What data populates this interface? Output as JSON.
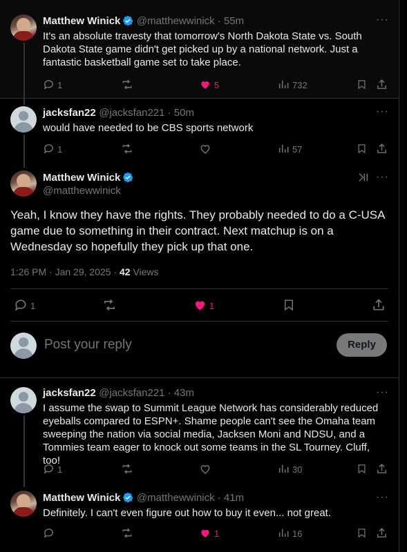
{
  "colors": {
    "background": "#000000",
    "text": "#e7e9ea",
    "muted": "#71767b",
    "like": "#f91880",
    "verified": "#1d9bf0",
    "divider": "#2f3336"
  },
  "tweet1": {
    "name": "Matthew Winick",
    "handle": "@matthewwinick · 55m",
    "text": "It's an absolute travesty that tomorrow's North Dakota State vs. South Dakota State game didn't get picked up by a national network. Just a fantastic basketball game set to take place.",
    "replies": "1",
    "reposts": "",
    "likes": "5",
    "views": "732",
    "liked": true
  },
  "tweet2": {
    "name": "jacksfan22",
    "handle": "@jacksfan221 · 50m",
    "text": "would have needed to be CBS sports network",
    "replies": "1",
    "reposts": "",
    "likes": "",
    "views": "57",
    "liked": false
  },
  "main": {
    "name": "Matthew Winick",
    "handle": "@matthewwinick",
    "text": "Yeah, I know they have the rights. They probably needed to do a C-USA game due to something in their contract. Next matchup is on a Wednesday so hopefully they pick up that one.",
    "meta_time": "1:26 PM · Jan 29, 2025 · ",
    "meta_views_count": "42",
    "meta_views_label": " Views",
    "replies": "1",
    "reposts": "",
    "likes": "1",
    "liked": true
  },
  "composer": {
    "placeholder": "Post your reply",
    "button": "Reply"
  },
  "tweet3": {
    "name": "jacksfan22",
    "handle": "@jacksfan221 · 43m",
    "text": "I assume the swap to Summit League Network has considerably reduced eyeballs compared to ESPN+. Shame people can't see the Omaha team sweeping the nation via social media, Jacksen Moni and NDSU, and a Tommies team eager to knock out some teams in the SL Tourney. Cluff, too!",
    "replies": "1",
    "reposts": "",
    "likes": "",
    "views": "30",
    "liked": false
  },
  "tweet4": {
    "name": "Matthew Winick",
    "handle": "@matthewwinick · 41m",
    "text": "Definitely. I can't even figure out how to buy it even... not great.",
    "replies": "",
    "reposts": "",
    "likes": "1",
    "views": "16",
    "liked": true
  }
}
